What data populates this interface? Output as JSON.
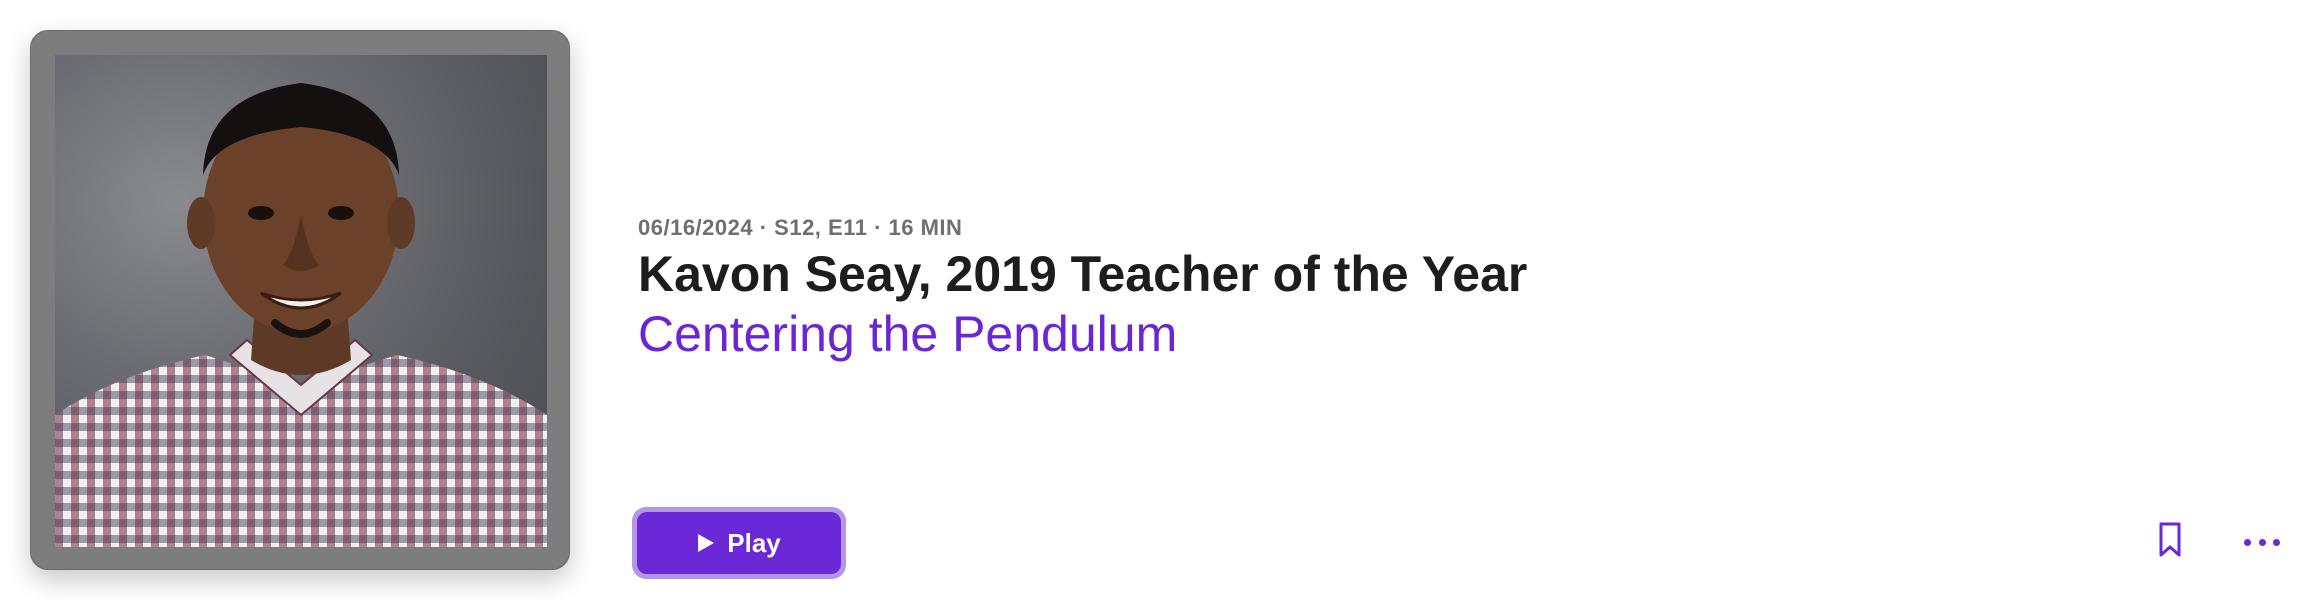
{
  "episode": {
    "meta": "06/16/2024 · S12, E11 · 16 MIN",
    "title": "Kavon Seay, 2019 Teacher of the Year",
    "show_name": "Centering the Pendulum"
  },
  "actions": {
    "play_label": "Play",
    "bookmark_icon": "bookmark-icon",
    "more_icon": "more-icon"
  },
  "artwork": {
    "subject": "portrait of smiling man in checkered shirt",
    "frame_color": "#7d7d7d"
  },
  "colors": {
    "accent": "#6a28d6",
    "accent_ring": "#b495ea",
    "title": "#1d1d1f",
    "meta": "#6e6e73"
  }
}
